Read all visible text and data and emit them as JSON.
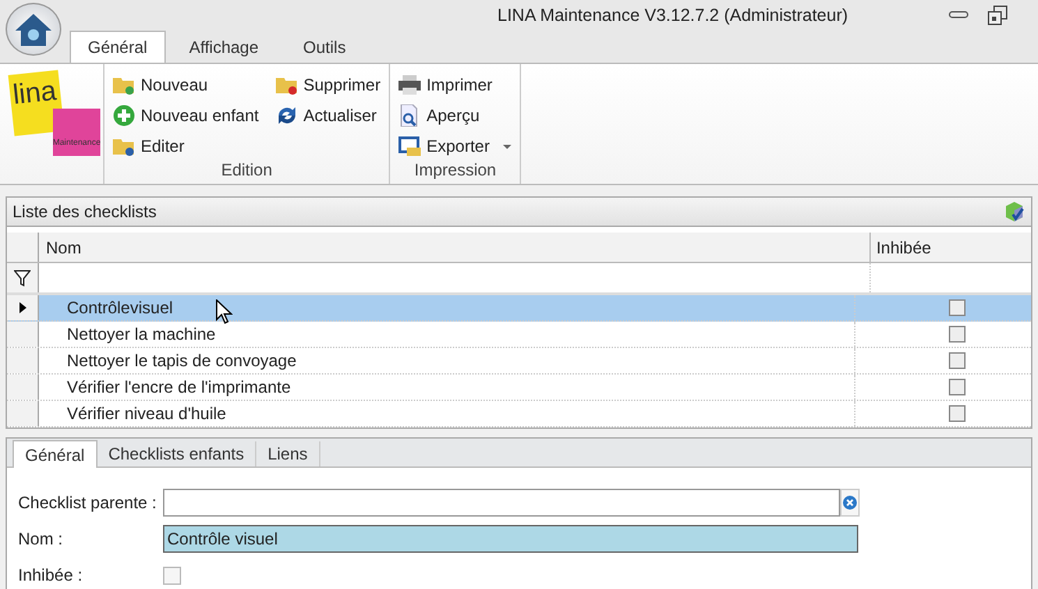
{
  "window": {
    "title": "LINA Maintenance  V3.12.7.2  (Administrateur)"
  },
  "ribbon_tabs": [
    {
      "label": "Général",
      "selected": true
    },
    {
      "label": "Affichage",
      "selected": false
    },
    {
      "label": "Outils",
      "selected": false
    }
  ],
  "logo": {
    "name": "lina",
    "tagline": "Maintenance"
  },
  "ribbon_groups": [
    {
      "label": "Edition",
      "columns": [
        [
          {
            "label": "Nouveau",
            "kind": "new"
          },
          {
            "label": "Nouveau enfant",
            "kind": "child"
          },
          {
            "label": "Editer",
            "kind": "edit"
          }
        ],
        [
          {
            "label": "Supprimer",
            "kind": "delete"
          },
          {
            "label": "Actualiser",
            "kind": "refresh"
          }
        ]
      ]
    },
    {
      "label": "Impression",
      "columns": [
        [
          {
            "label": "Imprimer",
            "kind": "print"
          },
          {
            "label": "Aperçu",
            "kind": "preview"
          },
          {
            "label": "Exporter",
            "kind": "export",
            "dropdown": true
          }
        ]
      ]
    }
  ],
  "list_panel": {
    "title": "Liste des checklists",
    "columns": [
      "Nom",
      "Inhibée"
    ],
    "rows": [
      {
        "name": "Contrôlevisuel",
        "inhibited": false,
        "selected": true
      },
      {
        "name": "Nettoyer la machine",
        "inhibited": false,
        "selected": false
      },
      {
        "name": "Nettoyer le tapis de convoyage",
        "inhibited": false,
        "selected": false
      },
      {
        "name": "Vérifier l'encre de l'imprimante",
        "inhibited": false,
        "selected": false
      },
      {
        "name": "Vérifier niveau d'huile",
        "inhibited": false,
        "selected": false
      }
    ]
  },
  "detail_tabs": [
    {
      "label": "Général",
      "selected": true
    },
    {
      "label": "Checklists enfants",
      "selected": false
    },
    {
      "label": "Liens",
      "selected": false
    }
  ],
  "form": {
    "parent_label": "Checklist parente :",
    "name_label": "Nom :",
    "name_value": "Contrôle visuel",
    "inhibited_label": "Inhibée :",
    "inhibited": false
  }
}
